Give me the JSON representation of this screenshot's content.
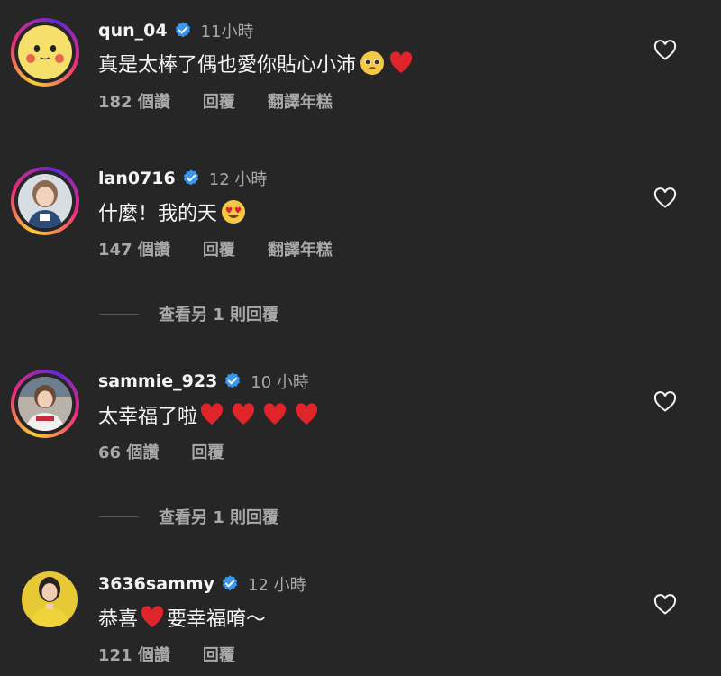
{
  "comments": [
    {
      "username": "qun_04",
      "time": "11小時",
      "text": "真是太棒了偶也愛你貼心小沛",
      "emojis": [
        "pleading-face-emoji",
        "red-heart-emoji"
      ],
      "likes": "182 個讚",
      "reply_label": "回覆",
      "translate_label": "翻譯年糕"
    },
    {
      "username": "lan0716",
      "time": "12 小時",
      "text": "什麼！我的天",
      "emojis": [
        "heart-eyes-emoji"
      ],
      "likes": "147 個讚",
      "reply_label": "回覆",
      "translate_label": "翻譯年糕",
      "view_replies": "查看另 1 則回覆"
    },
    {
      "username": "sammie_923",
      "time": "10 小時",
      "text": "太幸福了啦",
      "emojis": [
        "red-heart-emoji",
        "red-heart-emoji",
        "red-heart-emoji",
        "red-heart-emoji"
      ],
      "likes": "66 個讚",
      "reply_label": "回覆",
      "view_replies": "查看另 1 則回覆"
    },
    {
      "username": "3636sammy",
      "time": "12 小時",
      "text_before": "恭喜",
      "text_after": "要幸福唷～",
      "emojis": [
        "red-heart-emoji"
      ],
      "likes": "121 個讚",
      "reply_label": "回覆"
    }
  ],
  "colors": {
    "background": "#262626",
    "text": "#f5f5f5",
    "secondary": "#a8a8a8",
    "verified": "#3897f0",
    "heart": "#e0245e"
  }
}
